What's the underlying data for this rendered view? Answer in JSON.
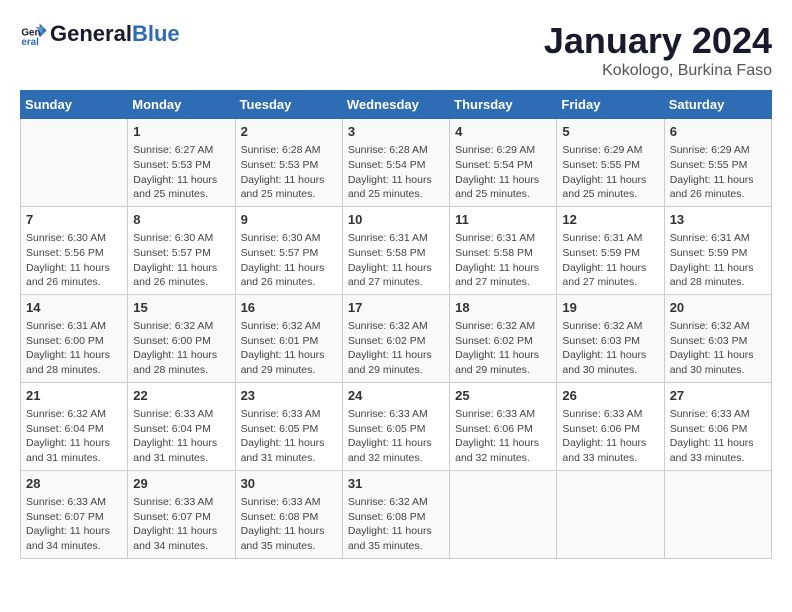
{
  "header": {
    "logo_line1": "General",
    "logo_line2": "Blue",
    "month": "January 2024",
    "location": "Kokologo, Burkina Faso"
  },
  "columns": [
    "Sunday",
    "Monday",
    "Tuesday",
    "Wednesday",
    "Thursday",
    "Friday",
    "Saturday"
  ],
  "weeks": [
    [
      {
        "day": "",
        "info": ""
      },
      {
        "day": "1",
        "info": "Sunrise: 6:27 AM\nSunset: 5:53 PM\nDaylight: 11 hours and 25 minutes."
      },
      {
        "day": "2",
        "info": "Sunrise: 6:28 AM\nSunset: 5:53 PM\nDaylight: 11 hours and 25 minutes."
      },
      {
        "day": "3",
        "info": "Sunrise: 6:28 AM\nSunset: 5:54 PM\nDaylight: 11 hours and 25 minutes."
      },
      {
        "day": "4",
        "info": "Sunrise: 6:29 AM\nSunset: 5:54 PM\nDaylight: 11 hours and 25 minutes."
      },
      {
        "day": "5",
        "info": "Sunrise: 6:29 AM\nSunset: 5:55 PM\nDaylight: 11 hours and 25 minutes."
      },
      {
        "day": "6",
        "info": "Sunrise: 6:29 AM\nSunset: 5:55 PM\nDaylight: 11 hours and 26 minutes."
      }
    ],
    [
      {
        "day": "7",
        "info": "Sunrise: 6:30 AM\nSunset: 5:56 PM\nDaylight: 11 hours and 26 minutes."
      },
      {
        "day": "8",
        "info": "Sunrise: 6:30 AM\nSunset: 5:57 PM\nDaylight: 11 hours and 26 minutes."
      },
      {
        "day": "9",
        "info": "Sunrise: 6:30 AM\nSunset: 5:57 PM\nDaylight: 11 hours and 26 minutes."
      },
      {
        "day": "10",
        "info": "Sunrise: 6:31 AM\nSunset: 5:58 PM\nDaylight: 11 hours and 27 minutes."
      },
      {
        "day": "11",
        "info": "Sunrise: 6:31 AM\nSunset: 5:58 PM\nDaylight: 11 hours and 27 minutes."
      },
      {
        "day": "12",
        "info": "Sunrise: 6:31 AM\nSunset: 5:59 PM\nDaylight: 11 hours and 27 minutes."
      },
      {
        "day": "13",
        "info": "Sunrise: 6:31 AM\nSunset: 5:59 PM\nDaylight: 11 hours and 28 minutes."
      }
    ],
    [
      {
        "day": "14",
        "info": "Sunrise: 6:31 AM\nSunset: 6:00 PM\nDaylight: 11 hours and 28 minutes."
      },
      {
        "day": "15",
        "info": "Sunrise: 6:32 AM\nSunset: 6:00 PM\nDaylight: 11 hours and 28 minutes."
      },
      {
        "day": "16",
        "info": "Sunrise: 6:32 AM\nSunset: 6:01 PM\nDaylight: 11 hours and 29 minutes."
      },
      {
        "day": "17",
        "info": "Sunrise: 6:32 AM\nSunset: 6:02 PM\nDaylight: 11 hours and 29 minutes."
      },
      {
        "day": "18",
        "info": "Sunrise: 6:32 AM\nSunset: 6:02 PM\nDaylight: 11 hours and 29 minutes."
      },
      {
        "day": "19",
        "info": "Sunrise: 6:32 AM\nSunset: 6:03 PM\nDaylight: 11 hours and 30 minutes."
      },
      {
        "day": "20",
        "info": "Sunrise: 6:32 AM\nSunset: 6:03 PM\nDaylight: 11 hours and 30 minutes."
      }
    ],
    [
      {
        "day": "21",
        "info": "Sunrise: 6:32 AM\nSunset: 6:04 PM\nDaylight: 11 hours and 31 minutes."
      },
      {
        "day": "22",
        "info": "Sunrise: 6:33 AM\nSunset: 6:04 PM\nDaylight: 11 hours and 31 minutes."
      },
      {
        "day": "23",
        "info": "Sunrise: 6:33 AM\nSunset: 6:05 PM\nDaylight: 11 hours and 31 minutes."
      },
      {
        "day": "24",
        "info": "Sunrise: 6:33 AM\nSunset: 6:05 PM\nDaylight: 11 hours and 32 minutes."
      },
      {
        "day": "25",
        "info": "Sunrise: 6:33 AM\nSunset: 6:06 PM\nDaylight: 11 hours and 32 minutes."
      },
      {
        "day": "26",
        "info": "Sunrise: 6:33 AM\nSunset: 6:06 PM\nDaylight: 11 hours and 33 minutes."
      },
      {
        "day": "27",
        "info": "Sunrise: 6:33 AM\nSunset: 6:06 PM\nDaylight: 11 hours and 33 minutes."
      }
    ],
    [
      {
        "day": "28",
        "info": "Sunrise: 6:33 AM\nSunset: 6:07 PM\nDaylight: 11 hours and 34 minutes."
      },
      {
        "day": "29",
        "info": "Sunrise: 6:33 AM\nSunset: 6:07 PM\nDaylight: 11 hours and 34 minutes."
      },
      {
        "day": "30",
        "info": "Sunrise: 6:33 AM\nSunset: 6:08 PM\nDaylight: 11 hours and 35 minutes."
      },
      {
        "day": "31",
        "info": "Sunrise: 6:32 AM\nSunset: 6:08 PM\nDaylight: 11 hours and 35 minutes."
      },
      {
        "day": "",
        "info": ""
      },
      {
        "day": "",
        "info": ""
      },
      {
        "day": "",
        "info": ""
      }
    ]
  ]
}
